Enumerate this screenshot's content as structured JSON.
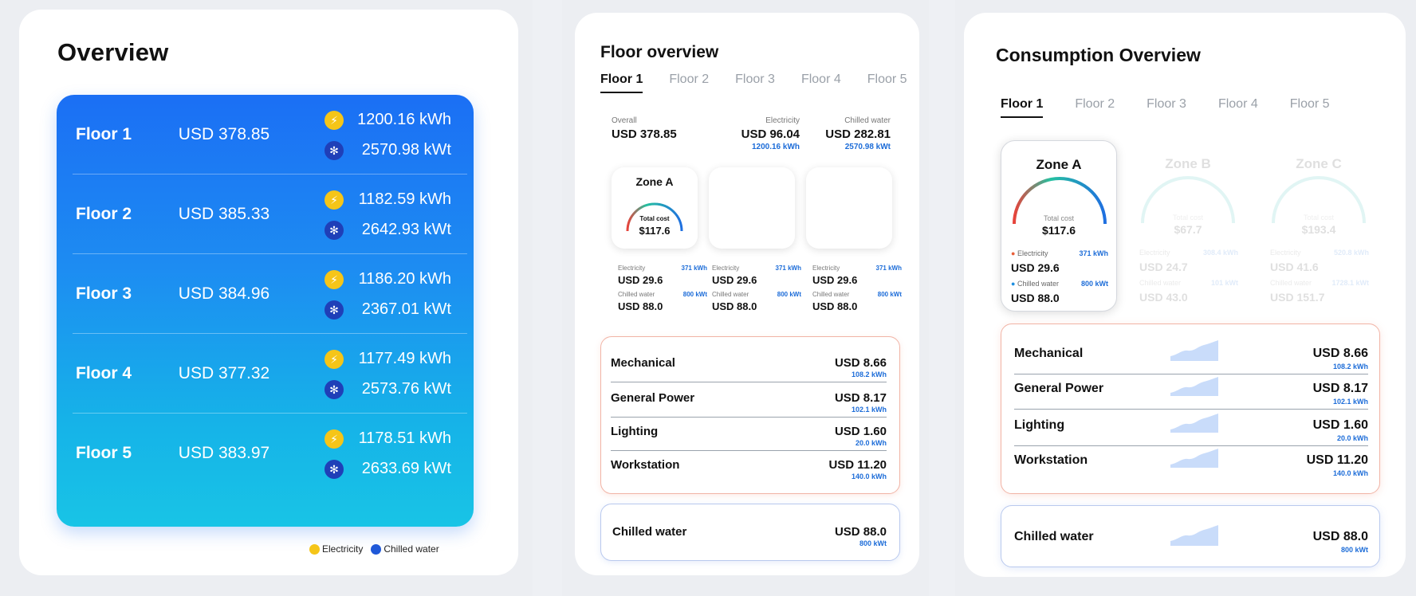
{
  "overview": {
    "title": "Overview",
    "floors": [
      {
        "name": "Floor 1",
        "cost": "USD 378.85",
        "electricity": "1200.16 kWh",
        "water": "2570.98 kWt"
      },
      {
        "name": "Floor 2",
        "cost": "USD 385.33",
        "electricity": "1182.59 kWh",
        "water": "2642.93 kWt"
      },
      {
        "name": "Floor 3",
        "cost": "USD 384.96",
        "electricity": "1186.20 kWh",
        "water": "2367.01 kWt"
      },
      {
        "name": "Floor 4",
        "cost": "USD 377.32",
        "electricity": "1177.49 kWh",
        "water": "2573.76 kWt"
      },
      {
        "name": "Floor 5",
        "cost": "USD 383.97",
        "electricity": "1178.51 kWh",
        "water": "2633.69 kWt"
      }
    ],
    "legend": {
      "electricity": "Electricity",
      "water": "Chilled water"
    }
  },
  "floor_overview": {
    "title": "Floor overview",
    "tabs": [
      "Floor 1",
      "Floor 2",
      "Floor 3",
      "Floor 4",
      "Floor 5"
    ],
    "summary": {
      "overall_label": "Overall",
      "overall_value": "USD 378.85",
      "elec_label": "Electricity",
      "elec_value": "USD 96.04",
      "elec_kwh": "1200.16 kWh",
      "water_label": "Chilled water",
      "water_value": "USD 282.81",
      "water_kwt": "2570.98 kWt"
    },
    "zone_a": {
      "name": "Zone A",
      "total_label": "Total cost",
      "total_value": "$117.6"
    },
    "zone_stats": {
      "elec_label": "Electricity",
      "elec_kwh": "371 kWh",
      "elec_value": "USD 29.6",
      "water_label": "Chilled water",
      "water_kwt": "800 kWt",
      "water_value": "USD 88.0"
    },
    "categories": [
      {
        "name": "Mechanical",
        "value": "USD 8.66",
        "kwh": "108.2 kWh"
      },
      {
        "name": "General Power",
        "value": "USD 8.17",
        "kwh": "102.1 kWh"
      },
      {
        "name": "Lighting",
        "value": "USD 1.60",
        "kwh": "20.0 kWh"
      },
      {
        "name": "Workstation",
        "value": "USD 11.20",
        "kwh": "140.0 kWh"
      }
    ],
    "chilled": {
      "name": "Chilled water",
      "value": "USD 88.0",
      "kwt": "800 kWt"
    }
  },
  "consumption": {
    "title": "Consumption Overview",
    "tabs": [
      "Floor 1",
      "Floor 2",
      "Floor 3",
      "Floor 4",
      "Floor 5"
    ],
    "zones": [
      {
        "name": "Zone A",
        "total_label": "Total cost",
        "total_value": "$117.6",
        "elec_label": "Electricity",
        "elec_kwh": "371 kWh",
        "elec_value": "USD 29.6",
        "water_label": "Chilled water",
        "water_kwt": "800 kWt",
        "water_value": "USD 88.0"
      },
      {
        "name": "Zone B",
        "total_label": "Total cost",
        "total_value": "$67.7",
        "elec_label": "Electricity",
        "elec_kwh": "308.4 kWh",
        "elec_value": "USD 24.7",
        "water_label": "Chilled water",
        "water_kwt": "101 kWt",
        "water_value": "USD 43.0"
      },
      {
        "name": "Zone C",
        "total_label": "Total cost",
        "total_value": "$193.4",
        "elec_label": "Electricity",
        "elec_kwh": "520.8 kWh",
        "elec_value": "USD 41.6",
        "water_label": "Chilled water",
        "water_kwt": "1728.1 kWt",
        "water_value": "USD 151.7"
      }
    ],
    "categories": [
      {
        "name": "Mechanical",
        "value": "USD 8.66",
        "kwh": "108.2 kWh"
      },
      {
        "name": "General Power",
        "value": "USD 8.17",
        "kwh": "102.1 kWh"
      },
      {
        "name": "Lighting",
        "value": "USD 1.60",
        "kwh": "20.0 kWh"
      },
      {
        "name": "Workstation",
        "value": "USD 11.20",
        "kwh": "140.0 kWh"
      }
    ],
    "chilled": {
      "name": "Chilled water",
      "value": "USD 88.0",
      "kwt": "800 kWt"
    }
  },
  "colors": {
    "gradient_top": "#1b6ff4",
    "gradient_bottom": "#18c4e6",
    "electricity": "#f5c518",
    "chilled_water": "#1f3fb8",
    "kwh_blue": "#1c6cd8",
    "category_border": "#f1b4a6",
    "chilled_border": "#b9c9ee"
  }
}
